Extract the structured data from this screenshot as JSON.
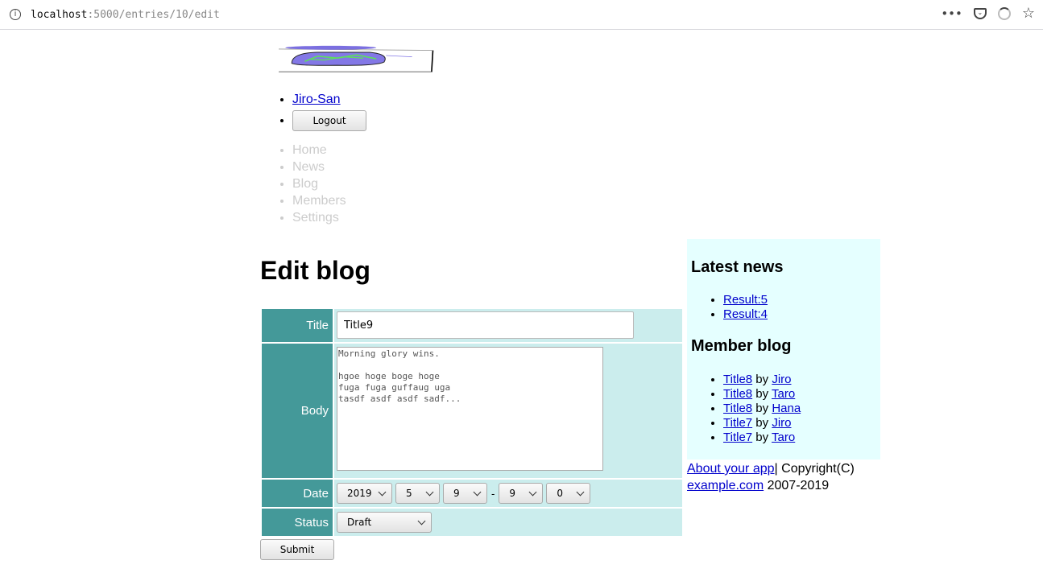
{
  "browser": {
    "url_host": "localhost",
    "url_rest": ":5000/entries/10/edit",
    "menu_dots": "•••",
    "bookmark_star": "☆"
  },
  "header": {
    "user_link": "Jiro-San",
    "logout_label": "Logout"
  },
  "nav": {
    "items": [
      "Home",
      "News",
      "Blog",
      "Members",
      "Settings"
    ]
  },
  "main": {
    "title": "Edit blog",
    "form": {
      "title_label": "Title",
      "title_value": "Title9",
      "body_label": "Body",
      "body_value": "Morning glory wins.\n\nhgoe hoge boge hoge\nfuga fuga guffaug uga\ntasdf asdf asdf sadf...",
      "date_label": "Date",
      "date_year": "2019",
      "date_month": "5",
      "date_day": "9",
      "date_separator": "-",
      "date_hour": "9",
      "date_minute": "0",
      "status_label": "Status",
      "status_value": "Draft",
      "submit_label": "Submit"
    }
  },
  "sidebar": {
    "news_heading": "Latest news",
    "news_items": [
      "Result:5",
      "Result:4"
    ],
    "blog_heading": "Member blog",
    "blog_by": "by",
    "blog_items": [
      {
        "title": "Title8",
        "author": "Jiro"
      },
      {
        "title": "Title8",
        "author": "Taro"
      },
      {
        "title": "Title8",
        "author": "Hana"
      },
      {
        "title": "Title7",
        "author": "Jiro"
      },
      {
        "title": "Title7",
        "author": "Taro"
      }
    ]
  },
  "footer": {
    "about_link": "About your app",
    "copyright_text": "| Copyright(C)",
    "company_link": "example.com",
    "years": "2007-2019"
  }
}
